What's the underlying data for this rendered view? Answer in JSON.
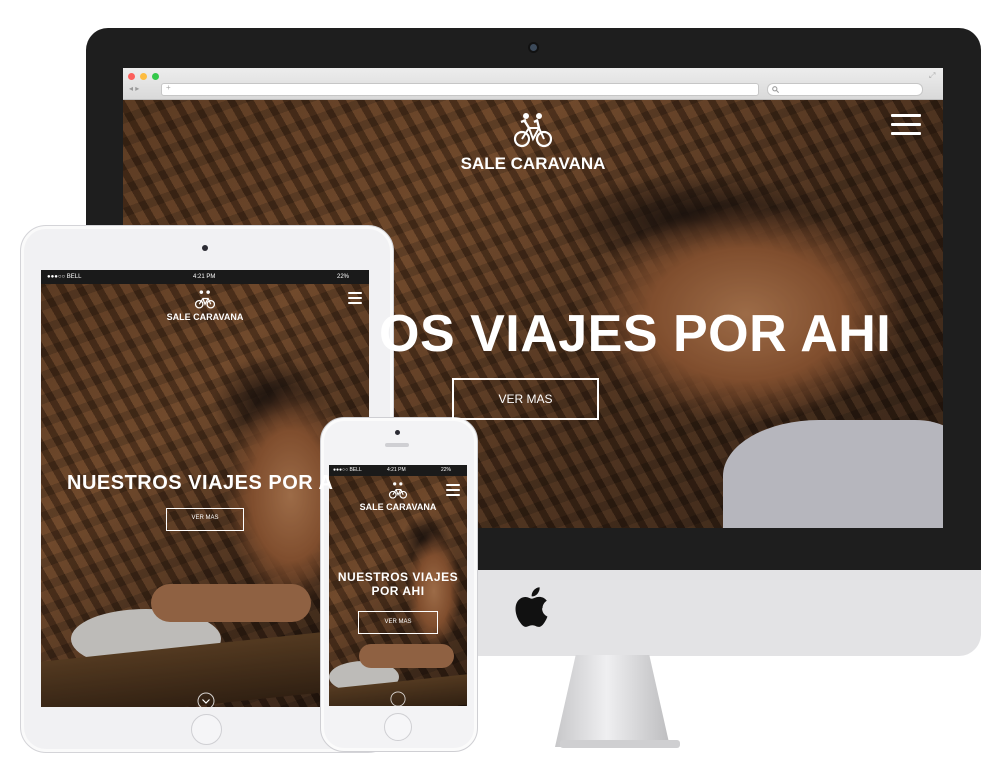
{
  "site": {
    "brand": "SALE CARAVANA",
    "hero_title_desktop_visible": "OS VIAJES POR AHI",
    "hero_title_tablet_visible": "NUESTROS VIAJES POR A",
    "hero_title_phone_line1": "NUESTROS VIAJES",
    "hero_title_phone_line2": "POR AHI",
    "cta_desktop": "VER MAS",
    "cta_mobile": "VER MAS"
  },
  "statusbar": {
    "carrier": "●●●○○ BELL",
    "time": "4:21 PM",
    "battery": "22%"
  },
  "colors": {
    "bezel": "#1e1e1e",
    "chin": "#e3e3e5",
    "device_silver": "#f1f1f3",
    "text": "#ffffff"
  },
  "icons": {
    "logo": "tandem-bicycle-logo",
    "menu": "hamburger-menu-icon",
    "apple": "apple-logo",
    "scroll": "chevron-down-circle-icon"
  }
}
